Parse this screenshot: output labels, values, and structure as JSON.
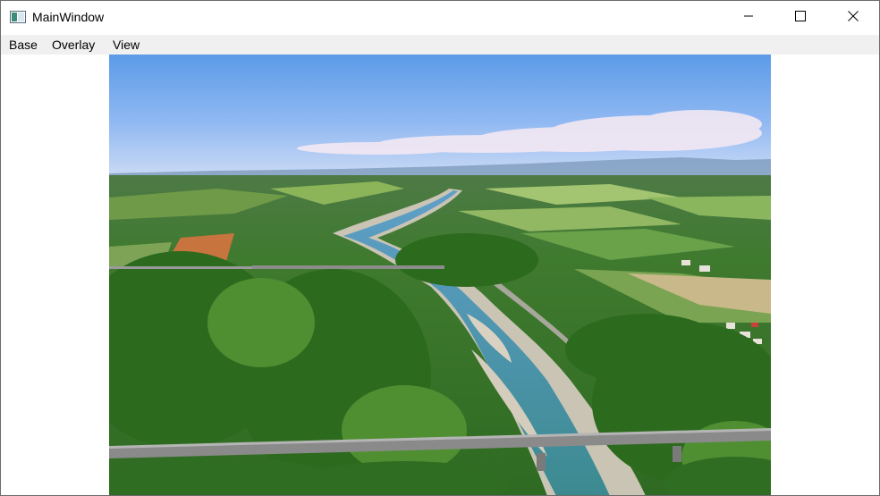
{
  "window": {
    "title": "MainWindow",
    "icons": {
      "app": "app-window-icon",
      "minimize": "minimize-icon",
      "maximize": "maximize-icon",
      "close": "close-icon"
    }
  },
  "menu": {
    "items": [
      {
        "label": "Base"
      },
      {
        "label": "Overlay"
      },
      {
        "label": "View"
      }
    ]
  },
  "image": {
    "description_icon": "aerial-river-photo"
  }
}
